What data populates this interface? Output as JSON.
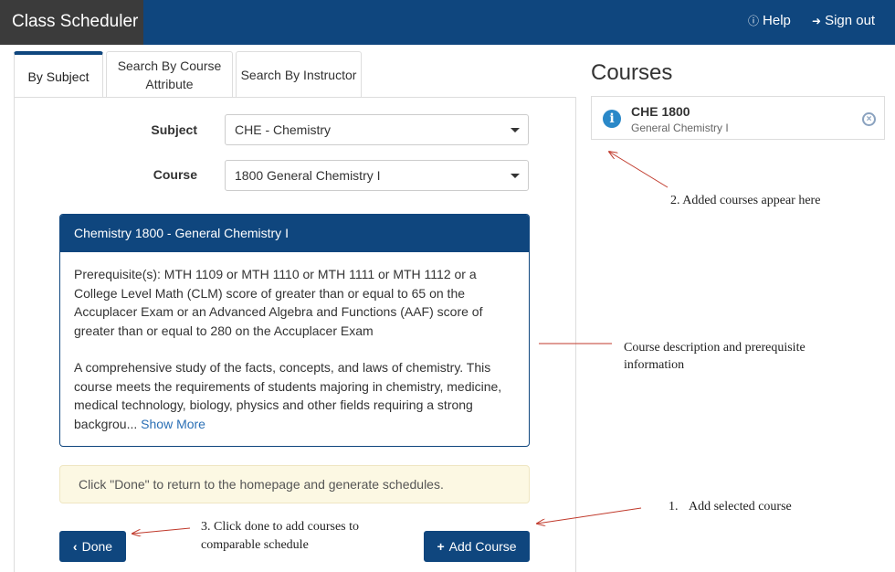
{
  "header": {
    "brand": "Class Scheduler",
    "help_label": "Help",
    "signout_label": "Sign out",
    "help_icon": "question-circle-icon",
    "signout_icon": "sign-out-icon"
  },
  "tabs": [
    {
      "label": "By Subject",
      "active": true
    },
    {
      "label": "Search By Course Attribute",
      "active": false
    },
    {
      "label": "Search By Instructor",
      "active": false
    }
  ],
  "form": {
    "subject_label": "Subject",
    "subject_value": "CHE - Chemistry",
    "course_label": "Course",
    "course_value": "1800 General Chemistry I"
  },
  "description": {
    "title": "Chemistry 1800 - General Chemistry I",
    "prerequisites": "Prerequisite(s): MTH 1109 or MTH 1110 or MTH 1111 or MTH 1112 or a College Level Math (CLM) score of greater than or equal to 65 on the Accuplacer Exam or an Advanced Algebra and Functions (AAF) score of greater than or equal to 280 on the Accuplacer Exam",
    "summary": "A comprehensive study of the facts, concepts, and laws of chemistry. This course meets the requirements of students majoring in chemistry, medicine, medical technology, biology, physics and other fields requiring a strong backgrou...",
    "show_more": "Show More"
  },
  "notice": "Click \"Done\" to return to the homepage and generate schedules.",
  "buttons": {
    "done_label": "Done",
    "add_course_label": "Add Course"
  },
  "courses": {
    "title": "Courses",
    "items": [
      {
        "code": "CHE 1800",
        "name": "General Chemistry I"
      }
    ]
  },
  "annotations": {
    "added_courses": "2. Added courses appear here",
    "description_info_line1": "Course description and prerequisite",
    "description_info_line2": "information",
    "add_selected_num": "1.",
    "add_selected": "Add selected course",
    "click_done_line1": "3. Click done to add courses to",
    "click_done_line2": "comparable schedule"
  },
  "colors": {
    "primary": "#0f467e",
    "brand_bg": "#3b3b3b",
    "annotation_arrow": "#c0392b"
  }
}
